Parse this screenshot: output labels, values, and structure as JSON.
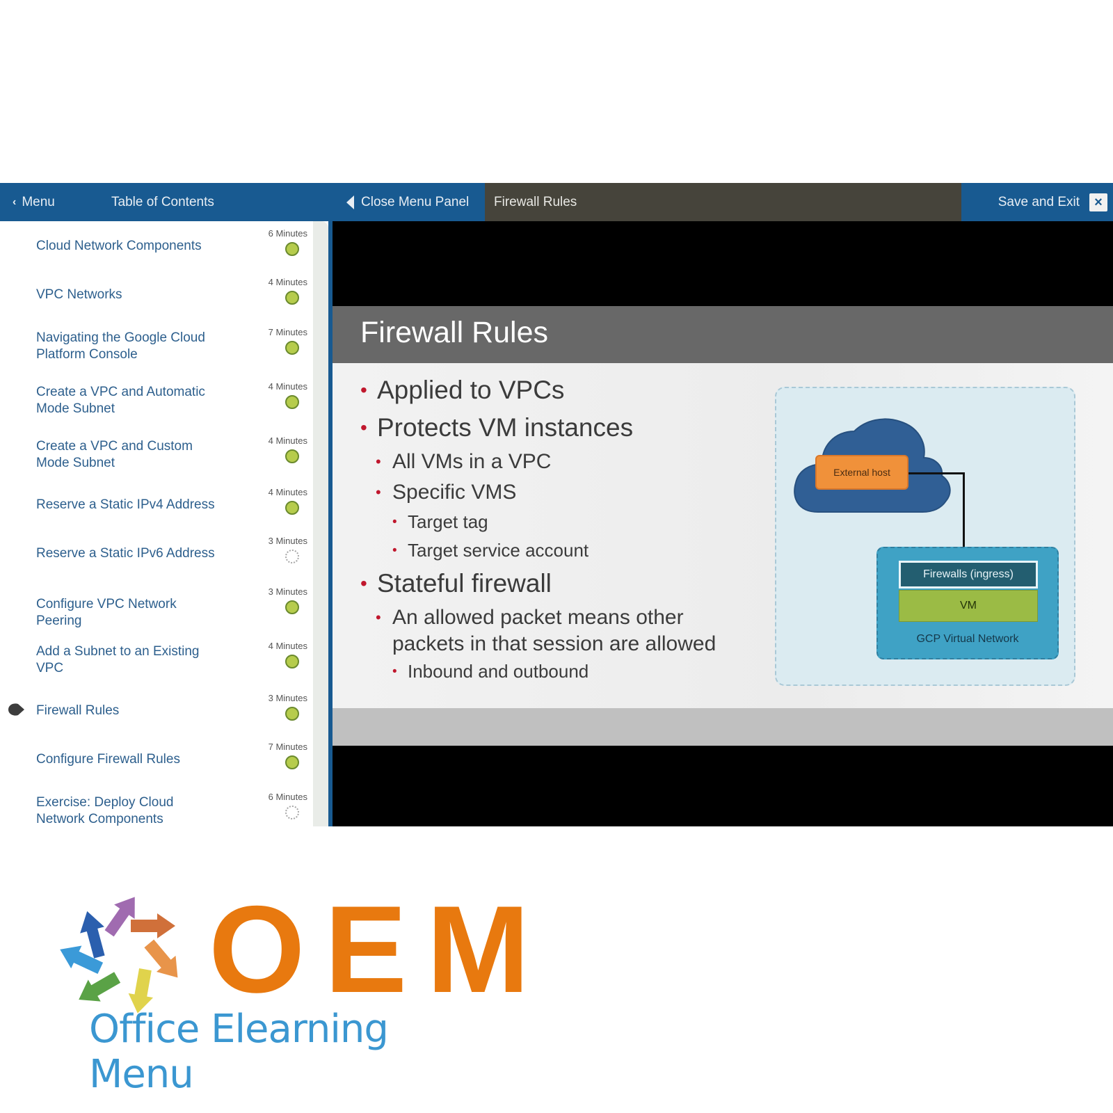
{
  "topbar": {
    "menu_label": "Menu",
    "toc_label": "Table of Contents",
    "close_panel_label": "Close Menu Panel",
    "lesson_title": "Firewall Rules",
    "save_exit_label": "Save and Exit",
    "close_icon": "×"
  },
  "toc": {
    "items": [
      {
        "label": "Cloud Network Components",
        "duration": "6 Minutes",
        "status": "complete",
        "current": false
      },
      {
        "label": "VPC Networks",
        "duration": "4 Minutes",
        "status": "complete",
        "current": false
      },
      {
        "label": "Navigating the Google Cloud Platform Console",
        "duration": "7 Minutes",
        "status": "complete",
        "current": false
      },
      {
        "label": "Create a VPC and Automatic Mode Subnet",
        "duration": "4 Minutes",
        "status": "complete",
        "current": false
      },
      {
        "label": "Create a VPC and Custom Mode Subnet",
        "duration": "4 Minutes",
        "status": "complete",
        "current": false
      },
      {
        "label": "Reserve a Static IPv4 Address",
        "duration": "4 Minutes",
        "status": "complete",
        "current": false
      },
      {
        "label": "Reserve a Static IPv6 Address",
        "duration": "3 Minutes",
        "status": "not-started",
        "current": false
      },
      {
        "label": "Configure VPC Network Peering",
        "duration": "3 Minutes",
        "status": "complete",
        "current": false
      },
      {
        "label": "Add a Subnet to an Existing VPC",
        "duration": "4 Minutes",
        "status": "complete",
        "current": false
      },
      {
        "label": "Firewall Rules",
        "duration": "3 Minutes",
        "status": "complete",
        "current": true
      },
      {
        "label": "Configure Firewall Rules",
        "duration": "7 Minutes",
        "status": "complete",
        "current": false
      },
      {
        "label": "Exercise: Deploy Cloud Network Components",
        "duration": "6 Minutes",
        "status": "not-started",
        "current": false
      }
    ]
  },
  "slide": {
    "title": "Firewall Rules",
    "bullets": [
      {
        "level": 1,
        "text": "Applied to VPCs"
      },
      {
        "level": 1,
        "text": "Protects VM instances"
      },
      {
        "level": 2,
        "text": "All VMs in a VPC"
      },
      {
        "level": 2,
        "text": "Specific VMS"
      },
      {
        "level": 3,
        "text": "Target tag"
      },
      {
        "level": 3,
        "text": "Target service account"
      },
      {
        "level": 1,
        "text": "Stateful firewall"
      },
      {
        "level": 2,
        "text": "An allowed packet means other packets in that session are allowed"
      },
      {
        "level": 3,
        "text": "Inbound and outbound"
      }
    ],
    "bullet_glyph": "•",
    "diagram": {
      "external_host": "External host",
      "firewall": "Firewalls (ingress)",
      "vm": "VM",
      "network": "GCP Virtual Network"
    }
  },
  "logo": {
    "brand": "OEM",
    "tagline": "Office Elearning Menu"
  },
  "colors": {
    "nav_blue": "#185a91",
    "header_dark": "#46443b",
    "status_complete": "#b6cc4c",
    "bullet_red": "#c0172d",
    "brand_orange": "#e8790f",
    "brand_blue": "#3b97d1"
  }
}
